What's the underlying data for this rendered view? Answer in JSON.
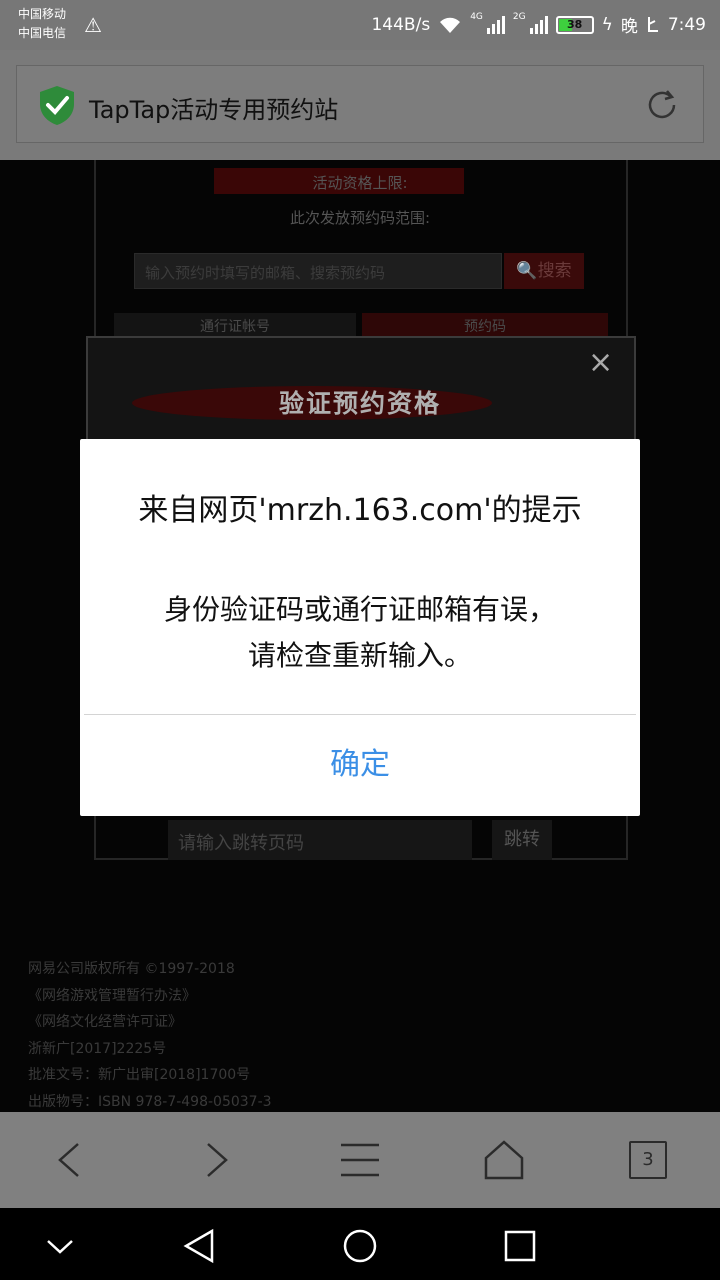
{
  "status_bar": {
    "carrier_1": "中国移动",
    "carrier_2": "中国电信",
    "net_speed": "144B/s",
    "signal_1_tag": "4G",
    "signal_2_tag": "2G",
    "battery_level": "38",
    "night_label": "晚",
    "time": "7:49",
    "battery_color": "#3ecf3e"
  },
  "address_bar": {
    "page_title": "TapTap活动专用预约站",
    "shield_color": "#2e8b3a"
  },
  "web_page": {
    "qualification_label": "活动资格上限:",
    "range_label": "此次发放预约码范围:",
    "range_value": "",
    "search_placeholder": "输入预约时填写的邮箱、搜索预约码",
    "search_button": "搜索",
    "tab_account": "通行证帐号",
    "tab_code": "预约码",
    "modal_heading": "验证预约资格",
    "modal_close": "×",
    "jump_placeholder": "请输入跳转页码",
    "jump_button": "跳转",
    "footer_lines": [
      "网易公司版权所有 ©1997-2018",
      "《网络游戏管理暂行办法》",
      "《网络文化经营许可证》",
      "浙新广[2017]2225号",
      "批准文号：新广出审[2018]1700号",
      "出版物号：ISBN 978-7-498-05037-3"
    ]
  },
  "dialog": {
    "title": "来自网页'mrzh.163.com'的提示",
    "message_line1": "身份验证码或通行证邮箱有误，",
    "message_line2": "请检查重新输入。",
    "ok_button": "确定",
    "ok_color": "#3b8fe6"
  },
  "toolbar": {
    "tab_count": "3"
  }
}
